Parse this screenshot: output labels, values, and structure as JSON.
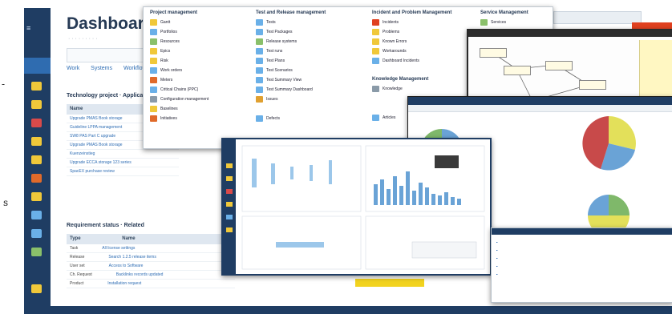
{
  "page_edge": {
    "left_dash": "-",
    "left_s": "s"
  },
  "app": {
    "logo": "≡",
    "title": "Dashboard",
    "subtitle": "· · · · · · · · ·",
    "nav_tabs": [
      "Work",
      "Systems",
      "Workflows"
    ],
    "section1_title": "Technology project · Applications",
    "table1_header": "Name",
    "table1_rows": [
      "Upgrade PMAS Book storage",
      "Guideline LPPA management",
      "SW8 PAS Part C upgrade",
      "Upgrade PMAS Book storage",
      "Kuenzeinstieg",
      "Upgrade ECCA storage 123 series",
      "SpacEX purchase review"
    ],
    "section2_title": "Requirement status · Related",
    "table2_headers": [
      "Type",
      "Name"
    ],
    "table2_rows": [
      {
        "type": "Task",
        "name": "All license settings"
      },
      {
        "type": "Release",
        "name": "Search 1.2.5 release items"
      },
      {
        "type": "User set",
        "name": "Access to Software"
      },
      {
        "type": "Ch. Request",
        "name": "Backlinks records updated"
      },
      {
        "type": "Product",
        "name": "Installation request"
      }
    ]
  },
  "menu": {
    "columns": [
      {
        "header": "Project management",
        "items": [
          "Gantt",
          "Portfolios",
          "Resources",
          "Epics",
          "Risk",
          "Work orders",
          "Meters",
          "Critical Chains (PPC)",
          "Configuration management",
          "Baselines",
          "Initiatives"
        ]
      },
      {
        "header": "Test and Release management",
        "items": [
          "Tests",
          "Test Packages",
          "Release systems",
          "Test runs",
          "Test Plans",
          "Test Scenarios",
          "Test Summary View",
          "Test Summary Dashboard",
          "Issues",
          "",
          "Defects"
        ]
      },
      {
        "header": "Incident and Problem Management",
        "items": [
          "Incidents",
          "Problems",
          "Known Errors",
          "Workarounds",
          "Dashboard Incidents",
          "",
          "Knowledge Management",
          "Knowledge",
          "",
          "",
          "Articles"
        ]
      },
      {
        "header": "Service Management",
        "items": [
          "Services"
        ]
      }
    ]
  },
  "colors": {
    "sidebar": "#1f3d63",
    "accent": "#2e6db4",
    "red_bar": "#e0401f",
    "pie_red": "#c84a4a",
    "pie_blue": "#6aa3d6",
    "pie_yellow": "#e3e05a",
    "pie_green": "#7fb86a",
    "bar_blue": "#9cc7ea"
  }
}
